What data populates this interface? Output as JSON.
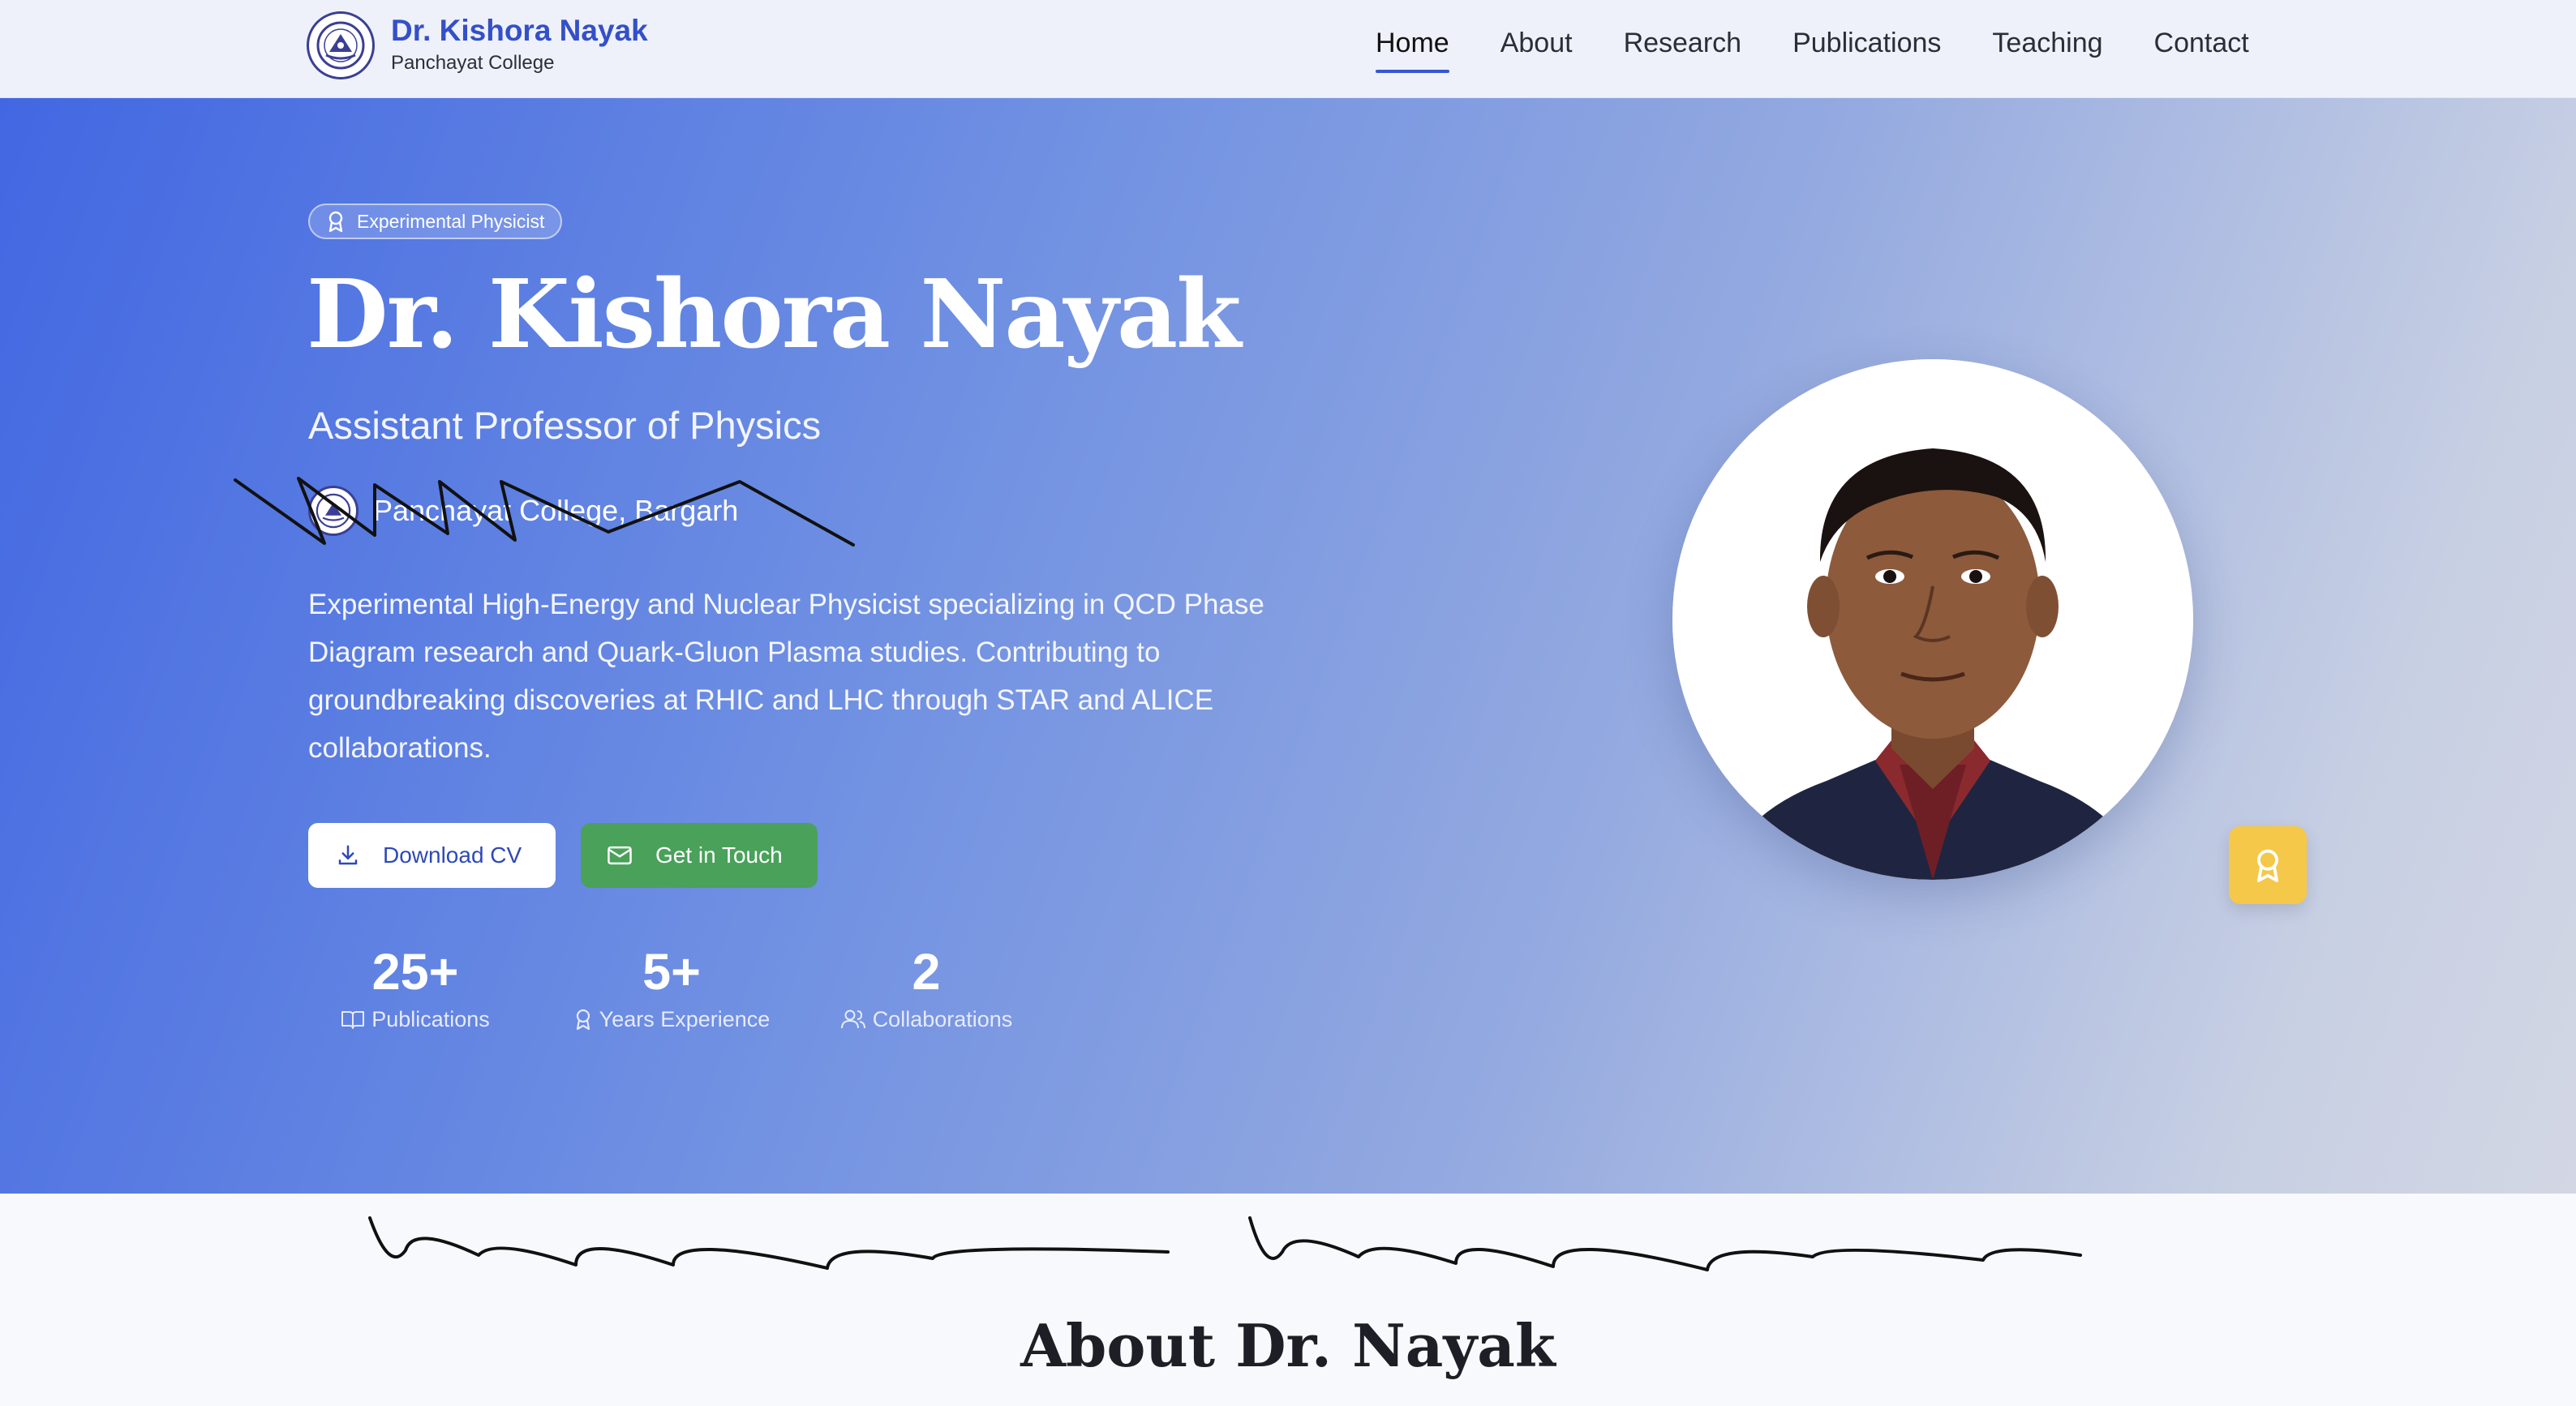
{
  "navbar": {
    "brand_name": "Dr. Kishora Nayak",
    "brand_sub": "Panchayat College",
    "links": [
      {
        "label": "Home",
        "active": true
      },
      {
        "label": "About"
      },
      {
        "label": "Research"
      },
      {
        "label": "Publications"
      },
      {
        "label": "Teaching"
      },
      {
        "label": "Contact"
      }
    ]
  },
  "hero": {
    "badge": "Experimental Physicist",
    "title": "Dr. Kishora Nayak",
    "role": "Assistant Professor of Physics",
    "institution": "Panchayat College, Bargarh",
    "description": "Experimental High-Energy and Nuclear Physicist specializing in QCD Phase Diagram research and Quark-Gluon Plasma studies. Contributing to groundbreaking discoveries at RHIC and LHC through STAR and ALICE collaborations.",
    "buttons": {
      "download_cv": "Download CV",
      "get_in_touch": "Get in Touch"
    },
    "stats": [
      {
        "value": "25+",
        "label": "Publications",
        "icon": "book-icon"
      },
      {
        "value": "5+",
        "label": "Years Experience",
        "icon": "award-icon"
      },
      {
        "value": "2",
        "label": "Collaborations",
        "icon": "users-icon"
      }
    ]
  },
  "about": {
    "title": "About Dr. Nayak"
  },
  "colors": {
    "accent": "#3557d4",
    "brand": "#3450c8",
    "green_button": "#4aa15a",
    "award_yellow": "#f5c84a"
  }
}
